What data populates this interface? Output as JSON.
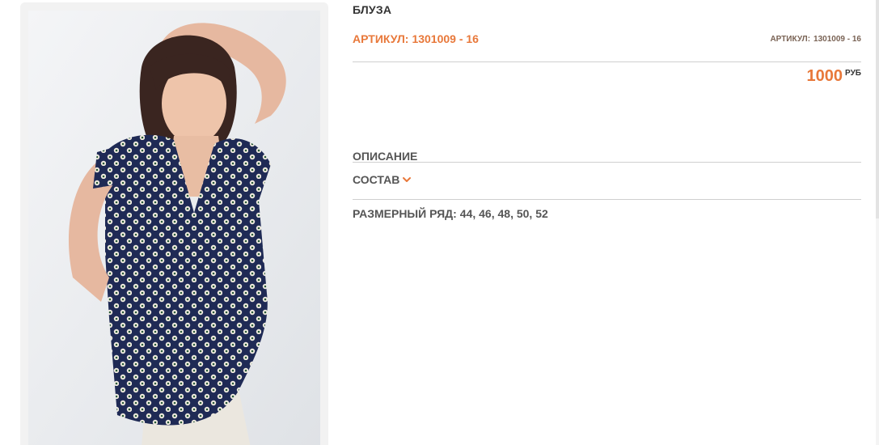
{
  "product": {
    "title": "БЛУЗА",
    "article_label": "АРТИКУЛ:",
    "article_value": "1301009 - 16",
    "side_article_label": "АРТИКУЛ:",
    "side_article_value": "1301009 - 16",
    "price": "1000",
    "currency": "РУБ",
    "description_label": "ОПИСАНИЕ",
    "composition_label": "СОСТАВ",
    "size_range_label": "РАЗМЕРНЫЙ РЯД:",
    "size_range_values": "44, 46, 48, 50, 52"
  },
  "colors": {
    "accent": "#e8783a",
    "text": "#555555",
    "title": "#333333",
    "rule": "#cfcfcf"
  },
  "icons": {
    "composition_toggle": "chevron-down-icon"
  },
  "image": {
    "subject": "product-photo"
  }
}
